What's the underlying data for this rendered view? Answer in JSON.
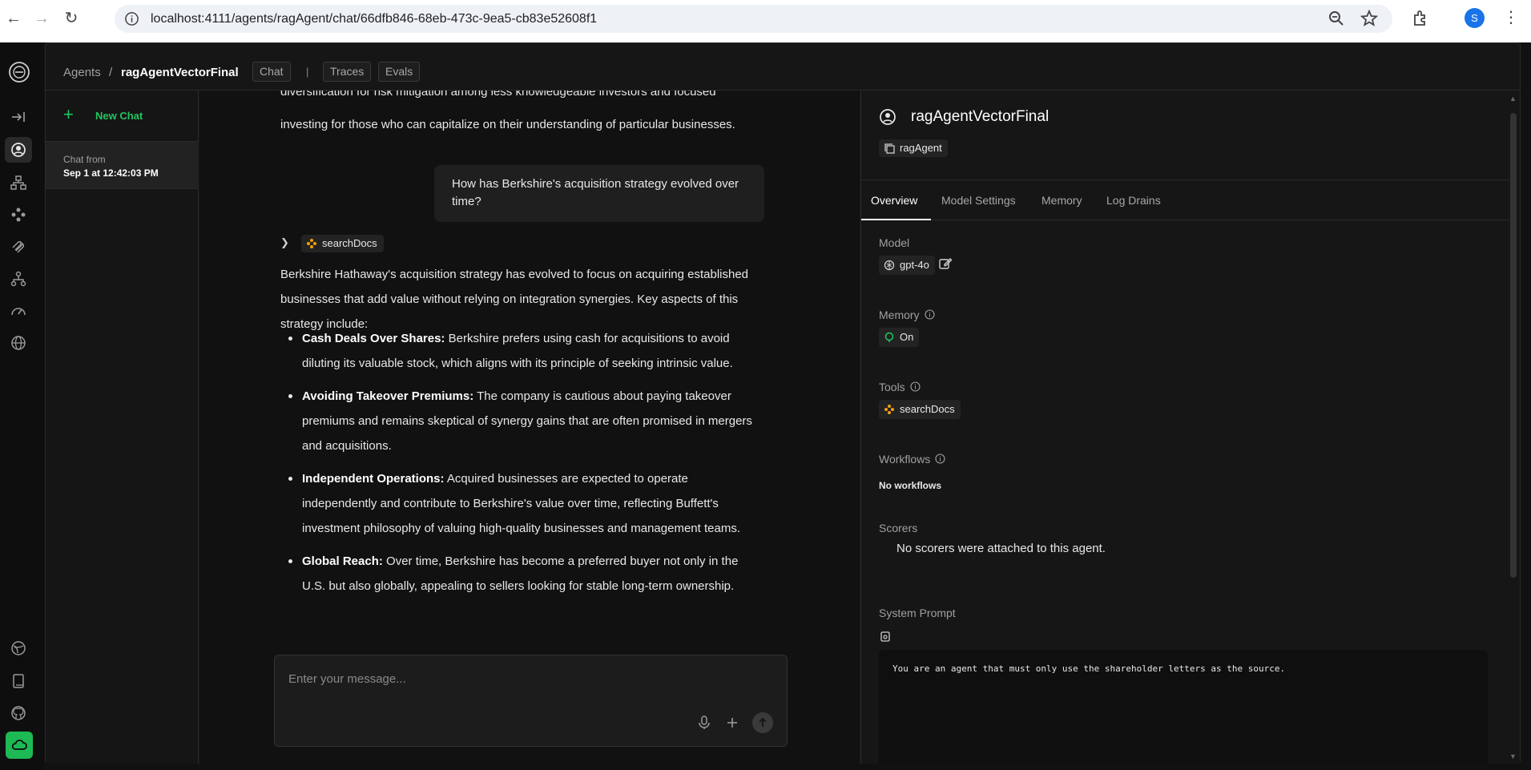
{
  "browser": {
    "url": "localhost:4111/agents/ragAgent/chat/66dfb846-68eb-473c-9ea5-cb83e52608f1",
    "profile_initial": "S"
  },
  "header": {
    "breadcrumb_root": "Agents",
    "breadcrumb_sep": "/",
    "agent_name": "ragAgentVectorFinal",
    "tabs": [
      "Chat",
      "Traces",
      "Evals"
    ],
    "tab_divider": "|"
  },
  "sidebar": {
    "new_chat_label": "New Chat",
    "chats": [
      {
        "title": "Chat from",
        "subtitle": "Sep 1 at 12:42:03 PM"
      }
    ]
  },
  "chat": {
    "partial_top_line1": "diversification for risk mitigation among less knowledgeable investors and focused",
    "partial_top_line2": "investing for those who can capitalize on their understanding of particular businesses.",
    "user_message": "How has Berkshire's acquisition strategy evolved over time?",
    "tool_call": "searchDocs",
    "answer_intro": "Berkshire Hathaway's acquisition strategy has evolved to focus on acquiring established businesses that add value without relying on integration synergies. Key aspects of this strategy include:",
    "bullets": [
      {
        "title": "Cash Deals Over Shares:",
        "text": " Berkshire prefers using cash for acquisitions to avoid diluting its valuable stock, which aligns with its principle of seeking intrinsic value."
      },
      {
        "title": "Avoiding Takeover Premiums:",
        "text": " The company is cautious about paying takeover premiums and remains skeptical of synergy gains that are often promised in mergers and acquisitions."
      },
      {
        "title": "Independent Operations:",
        "text": " Acquired businesses are expected to operate independently and contribute to Berkshire's value over time, reflecting Buffett's investment philosophy of valuing high-quality businesses and management teams."
      },
      {
        "title": "Global Reach:",
        "text": " Over time, Berkshire has become a preferred buyer not only in the U.S. but also globally, appealing to sellers looking for stable long-term ownership."
      }
    ],
    "input_placeholder": "Enter your message..."
  },
  "panel": {
    "agent_title": "ragAgentVectorFinal",
    "agent_id": "ragAgent",
    "tabs": [
      "Overview",
      "Model Settings",
      "Memory",
      "Log Drains"
    ],
    "active_tab": "Overview",
    "model_label": "Model",
    "model_value": "gpt-4o",
    "memory_label": "Memory",
    "memory_value": "On",
    "tools_label": "Tools",
    "tools": [
      "searchDocs"
    ],
    "workflows_label": "Workflows",
    "workflows_value": "No workflows",
    "scorers_label": "Scorers",
    "scorers_value": "No scorers were attached to this agent.",
    "system_prompt_label": "System Prompt",
    "system_prompt": "You are an agent that must only use the shareholder letters as the source."
  },
  "colors": {
    "accent_green": "#22c55e",
    "tool_orange": "#f59e0b",
    "background": "#111111"
  }
}
